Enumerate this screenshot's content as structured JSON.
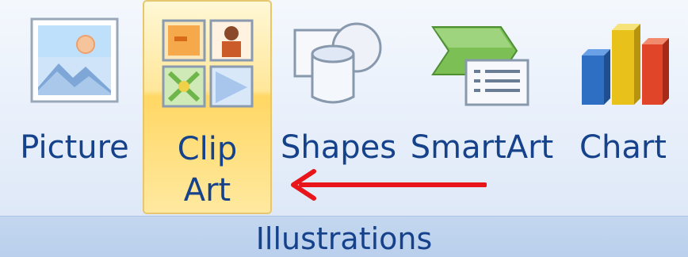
{
  "ribbon": {
    "group_title": "Illustrations",
    "buttons": {
      "picture": {
        "label": "Picture",
        "icon": "picture-icon"
      },
      "clip_art": {
        "label_line1": "Clip",
        "label_line2": "Art",
        "icon": "clip-art-icon",
        "state": "hovered"
      },
      "shapes": {
        "label": "Shapes",
        "icon": "shapes-icon"
      },
      "smartart": {
        "label": "SmartArt",
        "icon": "smartart-icon"
      },
      "chart": {
        "label": "Chart",
        "icon": "chart-icon"
      }
    }
  },
  "annotation": {
    "icon": "red-arrow-pointing-left",
    "color": "#e8161b"
  },
  "colors": {
    "label_text": "#15428b",
    "hover_fill": "#ffd764",
    "hover_border": "#e6c770",
    "footer_fill": "#c4d7ef"
  }
}
